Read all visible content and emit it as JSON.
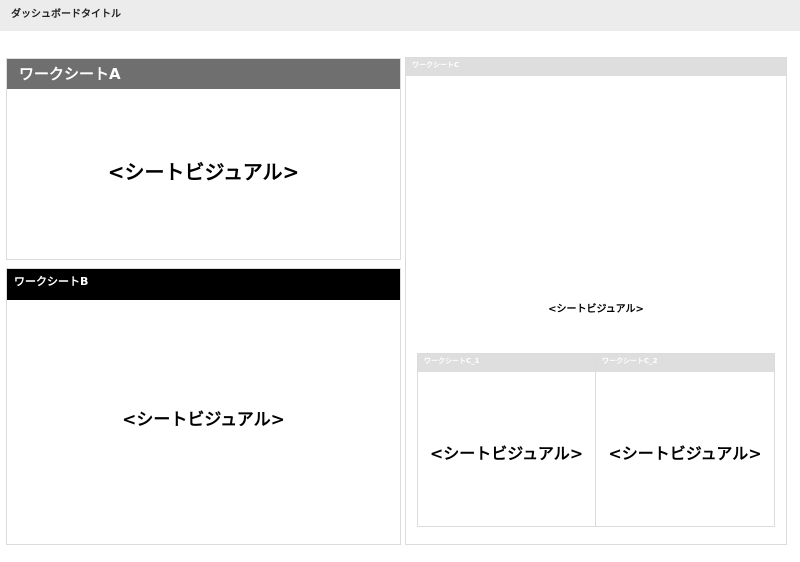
{
  "dashboard": {
    "title": "ダッシュボードタイトル"
  },
  "worksheets": {
    "a": {
      "title": "ワークシートA",
      "visual": "<シートビジュアル>"
    },
    "b": {
      "title": "ワークシートB",
      "visual": "<シートビジュアル>"
    },
    "c": {
      "title": "ワークシートC",
      "visual": "<シートビジュアル>",
      "c1": {
        "title": "ワークシートC_1",
        "visual": "<シートビジュアル>"
      },
      "c2": {
        "title": "ワークシートC_2",
        "visual": "<シートビジュアル>"
      }
    }
  },
  "colors": {
    "topbar_bg": "#ececec",
    "header_a_bg": "#6f6f6f",
    "header_dark_bg": "#000000",
    "header_c_bg": "#dedede",
    "panel_border": "#dcdcdc"
  }
}
